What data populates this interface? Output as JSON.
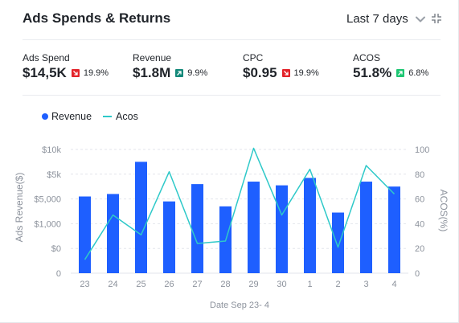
{
  "header": {
    "title": "Ads Spends & Returns",
    "range_label": "Last 7 days"
  },
  "metrics": [
    {
      "label": "Ads Spend",
      "value": "$14,5K",
      "change": "19.9%",
      "direction": "down",
      "color": "#e3242b"
    },
    {
      "label": "Revenue",
      "value": "$1.8M",
      "change": "9.9%",
      "direction": "up",
      "color": "#14897a"
    },
    {
      "label": "CPC",
      "value": "$0.95",
      "change": "19.9%",
      "direction": "down",
      "color": "#e3242b"
    },
    {
      "label": "ACOS",
      "value": "51.8%",
      "change": "6.8%",
      "direction": "up",
      "color": "#1ec773"
    }
  ],
  "legend": {
    "revenue": "Revenue",
    "acos": "Acos"
  },
  "colors": {
    "bar": "#1e5fff",
    "line": "#2ec9c9",
    "grid": "#e3e6eb",
    "axis_text": "#8c929c"
  },
  "chart_data": {
    "type": "bar",
    "categories": [
      "23",
      "24",
      "25",
      "26",
      "27",
      "28",
      "29",
      "30",
      "1",
      "2",
      "3",
      "4"
    ],
    "xlabel": "Date Sep 23- 4",
    "ylabel_left": "Ads Revenue($)",
    "ylabel_right": "ACOS(%)",
    "y_left_ticks": [
      "0",
      "$0",
      "$1,000",
      "$5,000",
      "$5k",
      "$10k"
    ],
    "y_right_ticks": [
      "0",
      "20",
      "40",
      "60",
      "80",
      "100"
    ],
    "ylim": [
      0,
      5
    ],
    "y2lim": [
      0,
      100
    ],
    "series": [
      {
        "name": "Revenue",
        "kind": "bar",
        "values": [
          3.1,
          3.2,
          4.5,
          2.9,
          3.6,
          2.7,
          3.7,
          3.55,
          3.85,
          2.45,
          3.7,
          3.5
        ]
      },
      {
        "name": "Acos",
        "kind": "line",
        "values": [
          11,
          47,
          31,
          82,
          24,
          26,
          101,
          47,
          84,
          21,
          87,
          64
        ]
      }
    ]
  }
}
